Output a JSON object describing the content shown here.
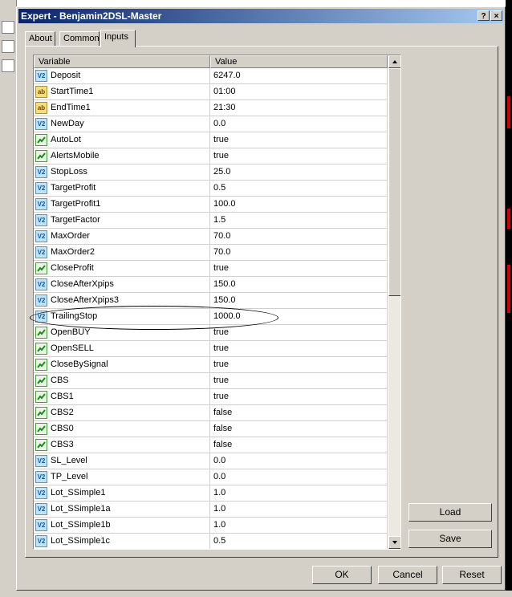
{
  "window": {
    "title": "Expert - Benjamin2DSL-Master",
    "help_label": "?",
    "close_label": "×"
  },
  "tabs": [
    {
      "label": "About",
      "active": false
    },
    {
      "label": "Common",
      "active": false
    },
    {
      "label": "Inputs",
      "active": true
    }
  ],
  "grid": {
    "columns": [
      "Variable",
      "Value"
    ],
    "rows": [
      {
        "name": "Deposit",
        "value": "6247.0",
        "type": "num"
      },
      {
        "name": "StartTime1",
        "value": "01:00",
        "type": "str"
      },
      {
        "name": "EndTime1",
        "value": "21:30",
        "type": "str"
      },
      {
        "name": "NewDay",
        "value": "0.0",
        "type": "num"
      },
      {
        "name": "AutoLot",
        "value": "true",
        "type": "bool"
      },
      {
        "name": "AlertsMobile",
        "value": "true",
        "type": "bool"
      },
      {
        "name": "StopLoss",
        "value": "25.0",
        "type": "num"
      },
      {
        "name": "TargetProfit",
        "value": "0.5",
        "type": "num"
      },
      {
        "name": "TargetProfit1",
        "value": "100.0",
        "type": "num"
      },
      {
        "name": "TargetFactor",
        "value": "1.5",
        "type": "num"
      },
      {
        "name": "MaxOrder",
        "value": "70.0",
        "type": "num"
      },
      {
        "name": "MaxOrder2",
        "value": "70.0",
        "type": "num"
      },
      {
        "name": "CloseProfit",
        "value": "true",
        "type": "bool"
      },
      {
        "name": "CloseAfterXpips",
        "value": "150.0",
        "type": "num"
      },
      {
        "name": "CloseAfterXpips3",
        "value": "150.0",
        "type": "num"
      },
      {
        "name": "TrailingStop",
        "value": "1000.0",
        "type": "num"
      },
      {
        "name": "OpenBUY",
        "value": "true",
        "type": "bool"
      },
      {
        "name": "OpenSELL",
        "value": "true",
        "type": "bool"
      },
      {
        "name": "CloseBySignal",
        "value": "true",
        "type": "bool"
      },
      {
        "name": "CBS",
        "value": "true",
        "type": "bool"
      },
      {
        "name": "CBS1",
        "value": "true",
        "type": "bool"
      },
      {
        "name": "CBS2",
        "value": "false",
        "type": "bool"
      },
      {
        "name": "CBS0",
        "value": "false",
        "type": "bool"
      },
      {
        "name": "CBS3",
        "value": "false",
        "type": "bool"
      },
      {
        "name": "SL_Level",
        "value": "0.0",
        "type": "num"
      },
      {
        "name": "TP_Level",
        "value": "0.0",
        "type": "num"
      },
      {
        "name": "Lot_SSimple1",
        "value": "1.0",
        "type": "num"
      },
      {
        "name": "Lot_SSimple1a",
        "value": "1.0",
        "type": "num"
      },
      {
        "name": "Lot_SSimple1b",
        "value": "1.0",
        "type": "num"
      },
      {
        "name": "Lot_SSimple1c",
        "value": "0.5",
        "type": "num"
      }
    ]
  },
  "side_buttons": {
    "load": "Load",
    "save": "Save"
  },
  "footer_buttons": {
    "ok": "OK",
    "cancel": "Cancel",
    "reset": "Reset"
  }
}
